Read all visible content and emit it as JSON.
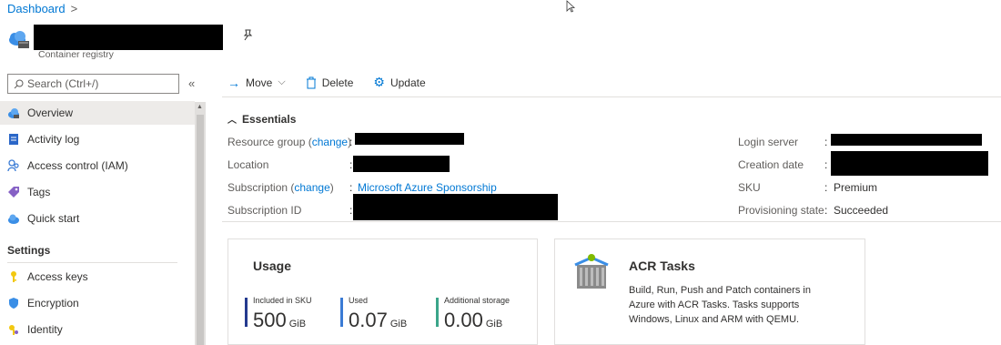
{
  "breadcrumb": {
    "items": [
      "Dashboard"
    ],
    "separator": ">"
  },
  "resource": {
    "type_label": "Container registry",
    "pin_icon": "pin-icon"
  },
  "sidebar": {
    "search_placeholder": "Search (Ctrl+/)",
    "collapse_icon": "«",
    "items": [
      {
        "label": "Overview",
        "icon": "cloud-icon",
        "active": true
      },
      {
        "label": "Activity log",
        "icon": "activity-log-icon"
      },
      {
        "label": "Access control (IAM)",
        "icon": "iam-icon"
      },
      {
        "label": "Tags",
        "icon": "tag-icon"
      },
      {
        "label": "Quick start",
        "icon": "quick-start-icon"
      }
    ],
    "settings_section": "Settings",
    "settings_items": [
      {
        "label": "Access keys",
        "icon": "key-icon"
      },
      {
        "label": "Encryption",
        "icon": "shield-icon"
      },
      {
        "label": "Identity",
        "icon": "identity-icon"
      }
    ]
  },
  "toolbar": {
    "move_label": "Move",
    "delete_label": "Delete",
    "update_label": "Update"
  },
  "essentials": {
    "title": "Essentials",
    "left": [
      {
        "label_pre": "Resource group (",
        "label_link": "change",
        "label_post": ")"
      },
      {
        "label_pre": "Location"
      },
      {
        "label_pre": "Subscription (",
        "label_link": "change",
        "label_post": ")",
        "value": "Microsoft Azure Sponsorship"
      },
      {
        "label_pre": "Subscription ID"
      }
    ],
    "right": [
      {
        "label": "Login server"
      },
      {
        "label": "Creation date"
      },
      {
        "label": "SKU",
        "value": "Premium"
      },
      {
        "label": "Provisioning state",
        "value": "Succeeded"
      }
    ]
  },
  "usage_card": {
    "title": "Usage",
    "metrics": [
      {
        "label": "Included in SKU",
        "value": "500",
        "unit": "GiB",
        "color": "#243a8f"
      },
      {
        "label": "Used",
        "value": "0.07",
        "unit": "GiB",
        "color": "#3a7bd5"
      },
      {
        "label": "Additional storage",
        "value": "0.00",
        "unit": "GiB",
        "color": "#3aa58a"
      }
    ]
  },
  "acr_card": {
    "title": "ACR Tasks",
    "description": "Build, Run, Push and Patch containers in Azure with ACR Tasks. Tasks supports Windows, Linux and ARM with QEMU."
  },
  "colors": {
    "accent": "#0078d4",
    "active_bg": "#edebe9",
    "redaction": "#000000"
  }
}
